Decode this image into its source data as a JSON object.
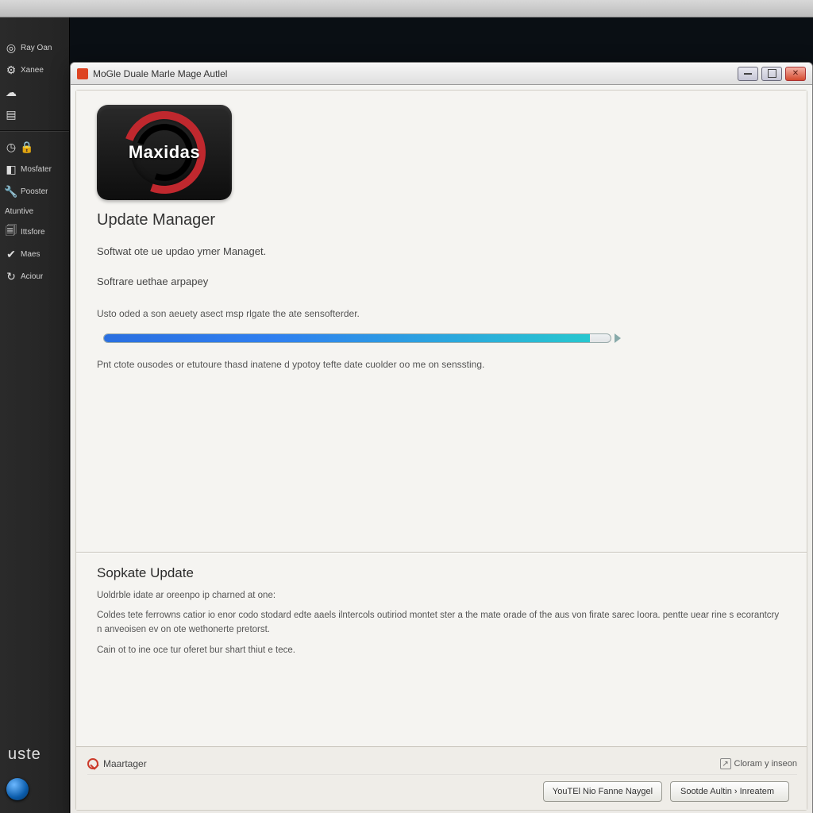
{
  "dock": {
    "items": [
      {
        "icon": "◎",
        "label": "Ray Oan"
      },
      {
        "icon": "⚙",
        "label": "Xanee"
      },
      {
        "icon": "☁",
        "label": ""
      },
      {
        "icon": "▤",
        "label": ""
      },
      {
        "icon": "◷",
        "label": ""
      },
      {
        "icon": "◧",
        "label": "Mosfater"
      },
      {
        "icon": "🔧",
        "label": "Pooster"
      },
      {
        "icon": " ",
        "label": "Atuntive"
      },
      {
        "icon": "🗐",
        "label": "Ittsfore"
      },
      {
        "icon": "✔",
        "label": "Maes"
      },
      {
        "icon": "↻",
        "label": "Aciour"
      }
    ],
    "brand": "uste"
  },
  "window": {
    "title": "MoGle Duale Marle Mage Autlel",
    "logo_text": "Maxidas",
    "heading": "Update Manager",
    "line1": "Softwat ote ue updao ymer Managet.",
    "line2": "Softrare uethae arpapey",
    "status": "Usto oded a son aeuety asect msp rlgate the ate sensofterder.",
    "hint": "Pnt ctote ousodes or etutoure thasd inatene d ypotoy tefte date cuolder oo me on senssting.",
    "progress_percent": 96
  },
  "lower": {
    "title": "Sopkate Update",
    "l1": "Uoldrble idate ar oreenpo ip charned at one:",
    "l2": "Coldes tete ferrowns catior io enor codo stodard edte aaels ilntercols outiriod montet ster a the mate orade of the aus von firate sarec Ioora. pentte uear rine s ecorantcry n anveoisen ev on ote wethonerte pretorst.",
    "l3": "Cain ot to ine oce tur oferet bur shart thiut e tece."
  },
  "footer": {
    "brand": "Maartager",
    "link": "Cloram y inseon",
    "btn1": "YouTEl Nio Fanne Naygel",
    "btn2": "Sootde Aultin › Inreatem"
  }
}
